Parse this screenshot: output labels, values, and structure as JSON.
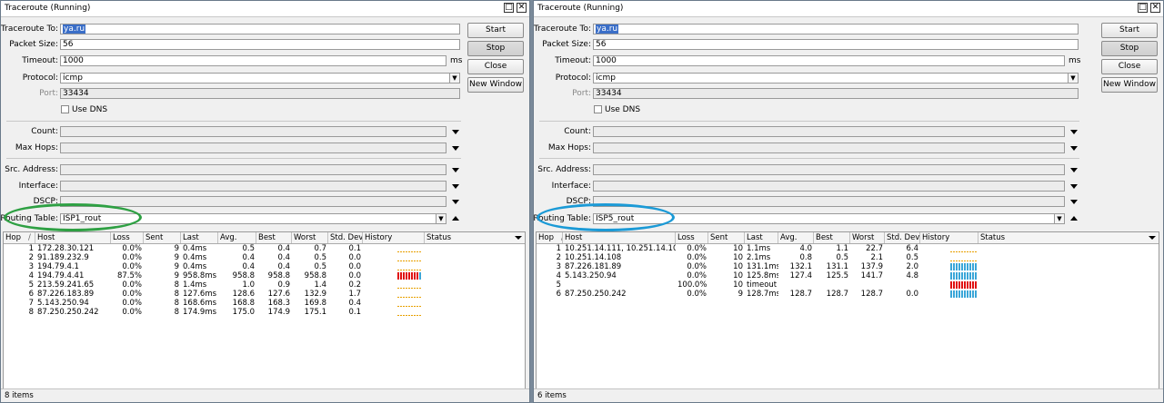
{
  "windows": [
    {
      "title": "Traceroute (Running)",
      "traceroute_to": "ya.ru",
      "packet_size": "56",
      "timeout": "1000",
      "timeout_unit": "ms",
      "protocol": "icmp",
      "port": "33434",
      "use_dns_label": "Use DNS",
      "routing_table": "ISP1_rout",
      "status_text": "8 items",
      "annotation_color": "#2ea043",
      "rows": [
        {
          "hop": "1",
          "host": "172.28.30.121",
          "loss": "0.0%",
          "sent": "9",
          "last": "0.4ms",
          "avg": "0.5",
          "best": "0.4",
          "worst": "0.7",
          "stddev": "0.1",
          "history": "low"
        },
        {
          "hop": "2",
          "host": "91.189.232.9",
          "loss": "0.0%",
          "sent": "9",
          "last": "0.4ms",
          "avg": "0.4",
          "best": "0.4",
          "worst": "0.5",
          "stddev": "0.0",
          "history": "low"
        },
        {
          "hop": "3",
          "host": "194.79.4.1",
          "loss": "0.0%",
          "sent": "9",
          "last": "0.4ms",
          "avg": "0.4",
          "best": "0.4",
          "worst": "0.5",
          "stddev": "0.0",
          "history": "low"
        },
        {
          "hop": "4",
          "host": "194.79.4.41",
          "loss": "87.5%",
          "sent": "9",
          "last": "958.8ms",
          "avg": "958.8",
          "best": "958.8",
          "worst": "958.8",
          "stddev": "0.0",
          "history": "loss"
        },
        {
          "hop": "5",
          "host": "213.59.241.65",
          "loss": "0.0%",
          "sent": "8",
          "last": "1.4ms",
          "avg": "1.0",
          "best": "0.9",
          "worst": "1.4",
          "stddev": "0.2",
          "history": "low"
        },
        {
          "hop": "6",
          "host": "87.226.183.89",
          "loss": "0.0%",
          "sent": "8",
          "last": "127.6ms",
          "avg": "128.6",
          "best": "127.6",
          "worst": "132.9",
          "stddev": "1.7",
          "history": "low"
        },
        {
          "hop": "7",
          "host": "5.143.250.94",
          "loss": "0.0%",
          "sent": "8",
          "last": "168.6ms",
          "avg": "168.8",
          "best": "168.3",
          "worst": "169.8",
          "stddev": "0.4",
          "history": "low"
        },
        {
          "hop": "8",
          "host": "87.250.250.242",
          "loss": "0.0%",
          "sent": "8",
          "last": "174.9ms",
          "avg": "175.0",
          "best": "174.9",
          "worst": "175.1",
          "stddev": "0.1",
          "history": "low"
        }
      ]
    },
    {
      "title": "Traceroute (Running)",
      "traceroute_to": "ya.ru",
      "packet_size": "56",
      "timeout": "1000",
      "timeout_unit": "ms",
      "protocol": "icmp",
      "port": "33434",
      "use_dns_label": "Use DNS",
      "routing_table": "ISP5_rout",
      "status_text": "6 items",
      "annotation_color": "#1b9ad6",
      "rows": [
        {
          "hop": "1",
          "host": "10.251.14.111, 10.251.14.109",
          "loss": "0.0%",
          "sent": "10",
          "last": "1.1ms",
          "avg": "4.0",
          "best": "1.1",
          "worst": "22.7",
          "stddev": "6.4",
          "history": "low"
        },
        {
          "hop": "2",
          "host": "10.251.14.108",
          "loss": "0.0%",
          "sent": "10",
          "last": "2.1ms",
          "avg": "0.8",
          "best": "0.5",
          "worst": "2.1",
          "stddev": "0.5",
          "history": "low"
        },
        {
          "hop": "3",
          "host": "87.226.181.89",
          "loss": "0.0%",
          "sent": "10",
          "last": "131.1ms",
          "avg": "132.1",
          "best": "131.1",
          "worst": "137.9",
          "stddev": "2.0",
          "history": "high"
        },
        {
          "hop": "4",
          "host": "5.143.250.94",
          "loss": "0.0%",
          "sent": "10",
          "last": "125.8ms",
          "avg": "127.4",
          "best": "125.5",
          "worst": "141.7",
          "stddev": "4.8",
          "history": "high"
        },
        {
          "hop": "5",
          "host": "",
          "loss": "100.0%",
          "sent": "10",
          "last": "timeout",
          "avg": "",
          "best": "",
          "worst": "",
          "stddev": "",
          "history": "loss"
        },
        {
          "hop": "6",
          "host": "87.250.250.242",
          "loss": "0.0%",
          "sent": "9",
          "last": "128.7ms",
          "avg": "128.7",
          "best": "128.7",
          "worst": "128.7",
          "stddev": "0.0",
          "history": "high"
        }
      ]
    }
  ],
  "labels": {
    "traceroute_to": "Traceroute To:",
    "packet_size": "Packet Size:",
    "timeout": "Timeout:",
    "protocol": "Protocol:",
    "port": "Port:",
    "count": "Count:",
    "max_hops": "Max Hops:",
    "src_address": "Src. Address:",
    "interface": "Interface:",
    "dscp": "DSCP:",
    "routing_table": "Routing Table:"
  },
  "buttons": {
    "start": "Start",
    "stop": "Stop",
    "close": "Close",
    "new_window": "New Window"
  },
  "columns": {
    "hop": "Hop",
    "host": "Host",
    "loss": "Loss",
    "sent": "Sent",
    "last": "Last",
    "avg": "Avg.",
    "best": "Best",
    "worst": "Worst",
    "stddev": "Std. Dev.",
    "history": "History",
    "status": "Status"
  },
  "colors": {
    "history_low": "#e8a000",
    "history_high": "#3aa6d8",
    "history_loss": "#e01010",
    "selection": "#3a6ec8"
  },
  "icons": {
    "maximize": "maximize-icon",
    "close": "close-icon",
    "dropdown": "chevron-down-icon",
    "collapse": "chevron-up-icon"
  }
}
